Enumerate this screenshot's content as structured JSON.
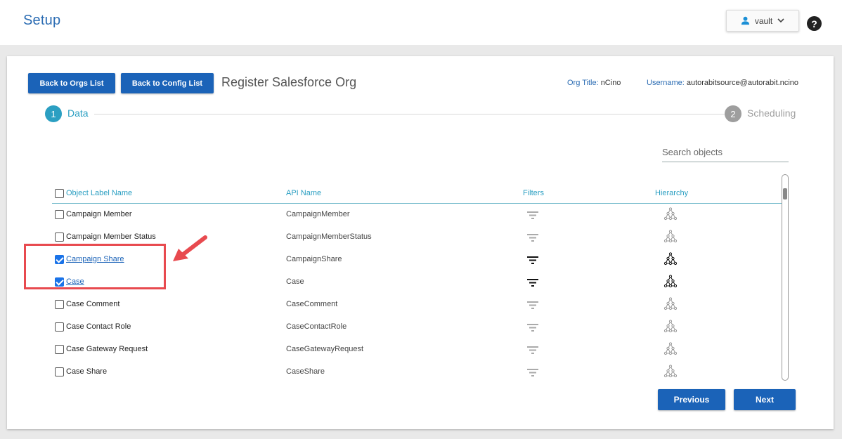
{
  "header": {
    "title": "Setup",
    "user_label": "vault",
    "help_label": "?"
  },
  "toolbar": {
    "back_orgs": "Back to Orgs List",
    "back_config": "Back to Config List",
    "page_title": "Register Salesforce Org",
    "org_title_key": "Org Title:",
    "org_title_value": "nCino",
    "username_key": "Username:",
    "username_value": "autorabitsource@autorabit.ncino"
  },
  "steps": [
    {
      "number": "1",
      "label": "Data",
      "active": true
    },
    {
      "number": "2",
      "label": "Scheduling",
      "active": false
    }
  ],
  "search": {
    "placeholder": "Search objects"
  },
  "table": {
    "columns": {
      "label": "Object Label Name",
      "api": "API Name",
      "filters": "Filters",
      "hierarchy": "Hierarchy"
    },
    "rows": [
      {
        "label": "Campaign Member",
        "api": "CampaignMember",
        "checked": false
      },
      {
        "label": "Campaign Member Status",
        "api": "CampaignMemberStatus",
        "checked": false
      },
      {
        "label": "Campaign Share",
        "api": "CampaignShare",
        "checked": true
      },
      {
        "label": "Case",
        "api": "Case",
        "checked": true
      },
      {
        "label": "Case Comment",
        "api": "CaseComment",
        "checked": false
      },
      {
        "label": "Case Contact Role",
        "api": "CaseContactRole",
        "checked": false
      },
      {
        "label": "Case Gateway Request",
        "api": "CaseGatewayRequest",
        "checked": false
      },
      {
        "label": "Case Share",
        "api": "CaseShare",
        "checked": false
      }
    ]
  },
  "footer": {
    "previous": "Previous",
    "next": "Next"
  },
  "colors": {
    "primary": "#1b63b8",
    "step_active": "#2b9fc2",
    "step_inactive": "#9e9e9e",
    "annotation": "#e84a4f"
  }
}
